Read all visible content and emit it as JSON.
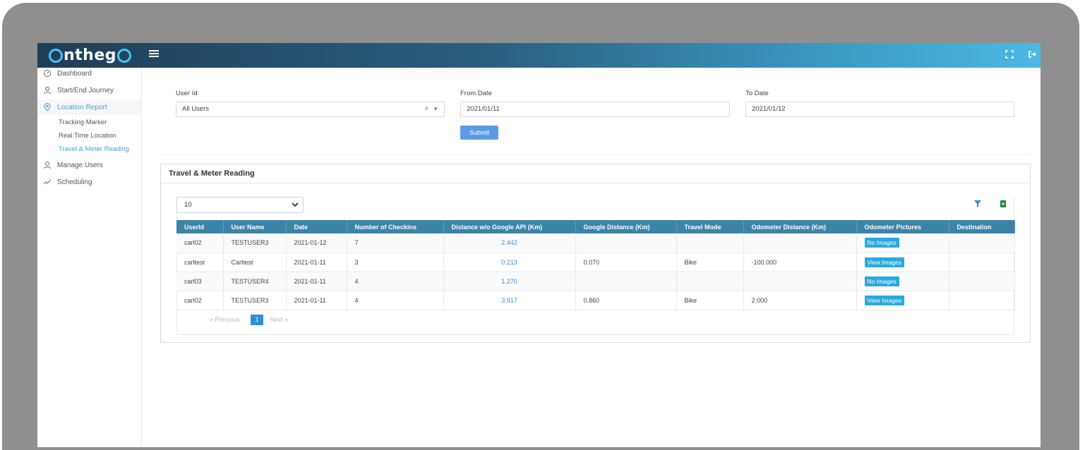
{
  "brand": {
    "logo_text_1": "",
    "logo_text_2": "nthe",
    "logo_text_3": "g",
    "logo_text_4": ""
  },
  "sidebar": {
    "items": [
      {
        "label": "Dashboard",
        "icon": "dashboard-icon"
      },
      {
        "label": "Start/End Journey",
        "icon": "user-icon"
      },
      {
        "label": "Location Report",
        "icon": "location-pin-icon",
        "active": true
      },
      {
        "label": "Manage Users",
        "icon": "user-icon"
      },
      {
        "label": "Scheduling",
        "icon": "trend-line-icon"
      }
    ],
    "subitems": [
      {
        "label": "Tracking Marker"
      },
      {
        "label": "Real Time Location"
      },
      {
        "label": "Travel & Meter Reading",
        "active": true
      }
    ]
  },
  "filters": {
    "user_id_label": "User Id",
    "user_id_value": "All Users",
    "from_date_label": "From Date",
    "from_date_value": "2021/01/11",
    "to_date_label": "To Date",
    "to_date_value": "2021/01/12",
    "submit_label": "Submit"
  },
  "report": {
    "title": "Travel & Meter Reading",
    "page_length": "10",
    "columns": [
      "UserId",
      "User Name",
      "Date",
      "Number of Checkins",
      "Distance w/o Google API (Km)",
      "Google Distance (Km)",
      "Travel Mode",
      "Odometer Distance (Km)",
      "Odometer Pictures",
      "Destination"
    ],
    "rows": [
      {
        "userid": "carl02",
        "username": "TESTUSER3",
        "date": "2021-01-12",
        "checkins": "7",
        "distance": "2.442",
        "google": "",
        "mode": "",
        "odometer": "",
        "pictures": "No Images",
        "destination": ""
      },
      {
        "userid": "carltest",
        "username": "Carltest",
        "date": "2021-01-11",
        "checkins": "3",
        "distance": "0.213",
        "google": "0.070",
        "mode": "Bike",
        "odometer": "-100.000",
        "pictures": "View Images",
        "destination": ""
      },
      {
        "userid": "carl03",
        "username": "TESTUSER4",
        "date": "2021-01-11",
        "checkins": "4",
        "distance": "1.270",
        "google": "",
        "mode": "",
        "odometer": "",
        "pictures": "No Images",
        "destination": ""
      },
      {
        "userid": "carl02",
        "username": "TESTUSER3",
        "date": "2021-01-11",
        "checkins": "4",
        "distance": "3.917",
        "google": "0.860",
        "mode": "Bike",
        "odometer": "2.000",
        "pictures": "View Images",
        "destination": ""
      }
    ],
    "pagination": {
      "previous": "« Previous",
      "current": "1",
      "next": "Next »"
    }
  },
  "colors": {
    "accent": "#3fa3d6",
    "header": "#3d83a8",
    "button": "#29a9e0",
    "submit": "#5b9be4"
  }
}
